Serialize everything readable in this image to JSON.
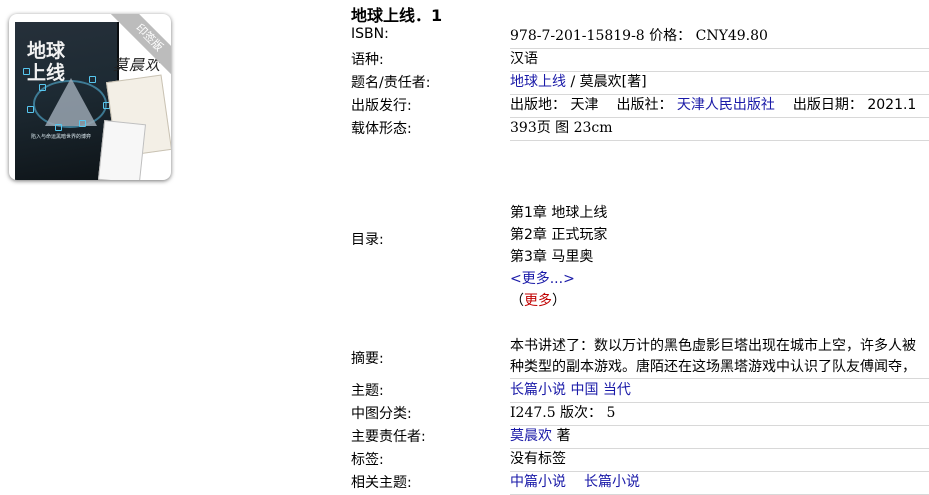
{
  "cover": {
    "title_line1": "地球",
    "title_line2": "上线",
    "ribbon": "印签版",
    "signature": "莫晨欢",
    "tagline": "陷入与命运黑暗世界的博弈"
  },
  "book": {
    "title": "地球上线．1",
    "isbn_label": "ISBN:",
    "isbn": "978-7-201-15819-8 价格： CNY49.80",
    "language_label": "语种:",
    "language": "汉语",
    "author_label": "题名/责任者:",
    "title_link": "地球上线",
    "author_rest": " / 莫晨欢[著]",
    "publish_label": "出版发行:",
    "publish_place": "出版地： 天津",
    "publisher_prefix": "出版社：",
    "publisher": "天津人民出版社",
    "publish_date": "出版日期： 2021.1",
    "format_label": "载体形态:",
    "format": "393页 图 23cm",
    "toc_label": "目录:",
    "toc": [
      "第1章 地球上线",
      "第2章 正式玩家",
      "第3章 马里奥"
    ],
    "toc_more": "<更多...>",
    "toc_more_paren_open": "（",
    "toc_more_red": "更多",
    "toc_more_paren_close": "）",
    "abstract_label": "摘要:",
    "abstract_line1": "本书讲述了：数以万计的黑色虚影巨塔出现在城市上空，许多人被",
    "abstract_line2": "种类型的副本游戏。唐陌还在这场黑塔游戏中认识了队友傅闻夺，",
    "subject_label": "主题:",
    "subject": "长篇小说 中国 当代",
    "clc_label": "中图分类:",
    "clc": "I247.5 版次： 5",
    "main_author_label": "主要责任者:",
    "main_author": "莫晨欢",
    "main_author_role": " 著",
    "tags_label": "标签:",
    "tags": "没有标签",
    "related_label": "相关主题:",
    "related_1": "中篇小说",
    "related_2": "长篇小说"
  }
}
